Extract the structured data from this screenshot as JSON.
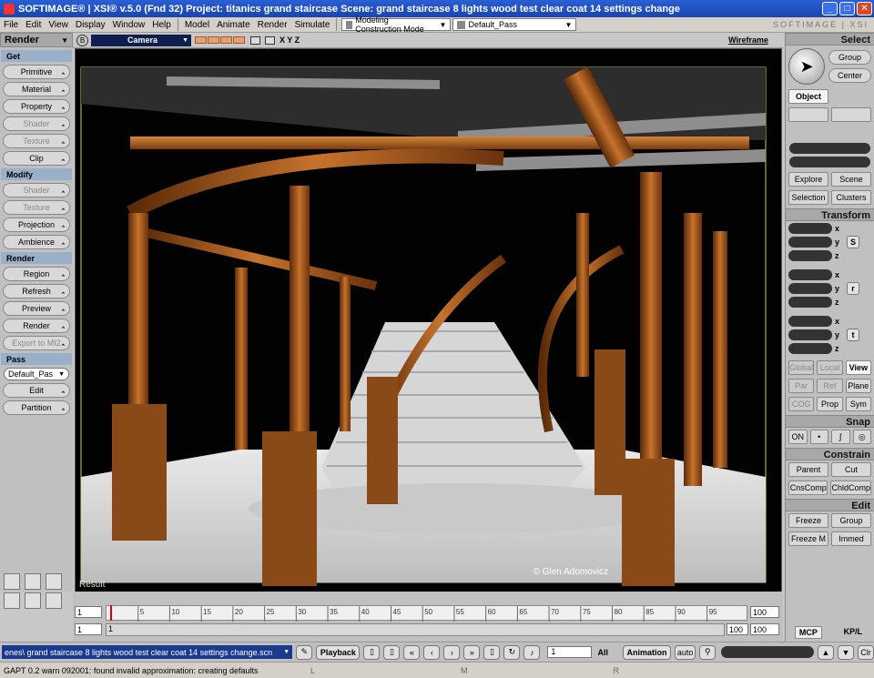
{
  "title": "SOFTIMAGE® | XSI® v.5.0 (Fnd 32) Project: titanics grand staircase    Scene:  grand staircase 8 lights wood test clear coat 14 settings change",
  "window_buttons": [
    "_",
    "□",
    "✕"
  ],
  "menu": {
    "items_left": [
      "File",
      "Edit",
      "View",
      "Display",
      "Window",
      "Help"
    ],
    "items_right": [
      "Model",
      "Animate",
      "Render",
      "Simulate"
    ],
    "construction_mode": "Modeling Construction Mode",
    "pass": "Default_Pass",
    "logo": "SOFTIMAGE | XSI"
  },
  "left_panel": {
    "header": "Render",
    "sections": [
      {
        "title": "Get",
        "buttons": [
          {
            "label": "Primitive",
            "disabled": false
          },
          {
            "label": "Material",
            "disabled": false
          },
          {
            "label": "Property",
            "disabled": false
          },
          {
            "label": "Shader",
            "disabled": true
          },
          {
            "label": "Texture",
            "disabled": true
          },
          {
            "label": "Clip",
            "disabled": false
          }
        ]
      },
      {
        "title": "Modify",
        "buttons": [
          {
            "label": "Shader",
            "disabled": true
          },
          {
            "label": "Texture",
            "disabled": true
          },
          {
            "label": "Projection",
            "disabled": false
          },
          {
            "label": "Ambience",
            "disabled": false
          }
        ]
      },
      {
        "title": "Render",
        "buttons": [
          {
            "label": "Region",
            "disabled": false
          },
          {
            "label": "Refresh",
            "disabled": false
          },
          {
            "label": "Preview",
            "disabled": false
          },
          {
            "label": "Render",
            "disabled": false
          },
          {
            "label": "Export to MI2",
            "disabled": true
          }
        ]
      },
      {
        "title": "Pass",
        "buttons": []
      }
    ],
    "pass_select": "Default_Pas",
    "pass_buttons": [
      "Edit",
      "Partition"
    ]
  },
  "viewport": {
    "toolbar_b": "B",
    "camera": "Camera",
    "axes": "X Y Z",
    "display_mode": "Wireframe",
    "result_label": "Result",
    "credit": "© Glen Adomovicz"
  },
  "right_panel": {
    "select_header": "Select",
    "group": "Group",
    "center": "Center",
    "object": "Object",
    "explore": "Explore",
    "scene": "Scene",
    "selection": "Selection",
    "clusters": "Clusters",
    "transform_header": "Transform",
    "xyz": [
      "x",
      "y",
      "z"
    ],
    "tools": [
      "S",
      "r",
      "t"
    ],
    "global": "Global",
    "local": "Local",
    "view": "View",
    "par": "Par",
    "ref": "Ref",
    "plane": "Plane",
    "cog": "COG",
    "prop": "Prop",
    "sym": "Sym",
    "snap_header": "Snap",
    "on": "ON",
    "constrain_header": "Constrain",
    "parent": "Parent",
    "cut": "Cut",
    "cnscomp": "CnsComp",
    "chldcomp": "ChldComp",
    "edit_header": "Edit",
    "freeze": "Freeze",
    "edit_group": "Group",
    "freeze_m": "Freeze M",
    "immed": "Immed",
    "mcp": "MCP",
    "kpl": "KP/L"
  },
  "timeline": {
    "start": "1",
    "end": "100",
    "range_start": "1",
    "range_end": "100",
    "range_end2": "100",
    "current": "1",
    "ticks": [
      5,
      10,
      15,
      20,
      25,
      30,
      35,
      40,
      45,
      50,
      55,
      60,
      65,
      70,
      75,
      80,
      85,
      90,
      95
    ]
  },
  "playback": {
    "scene_path": "enes\\ grand staircase 8 lights wood test clear coat 14 settings change.scn",
    "playback_label": "Playback",
    "frame": "1",
    "all_label": "All",
    "animation_label": "Animation",
    "auto_label": "auto",
    "clr": "Clr"
  },
  "status": {
    "message": "GAPT 0.2  warn    092001: found invalid approximation: creating defaults",
    "mouse": [
      "L",
      "M",
      "R"
    ]
  }
}
